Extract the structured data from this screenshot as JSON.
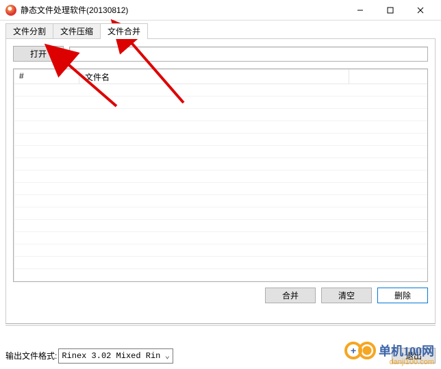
{
  "window": {
    "title": "静态文件处理软件(20130812)"
  },
  "tabs": [
    {
      "label": "文件分割",
      "active": false
    },
    {
      "label": "文件压缩",
      "active": false
    },
    {
      "label": "文件合并",
      "active": true
    }
  ],
  "toolbar": {
    "open_label": "打开",
    "path_value": ""
  },
  "table": {
    "columns": {
      "index": "#",
      "name": "文件名"
    },
    "rows": []
  },
  "actions": {
    "merge": "合并",
    "clear": "清空",
    "delete": "删除"
  },
  "output": {
    "label": "输出文件格式:",
    "selected": "Rinex 3.02 Mixed Rin"
  },
  "exit": {
    "label": "退出"
  },
  "watermark": {
    "line1": "单机100网",
    "line2": "danji100.com"
  }
}
